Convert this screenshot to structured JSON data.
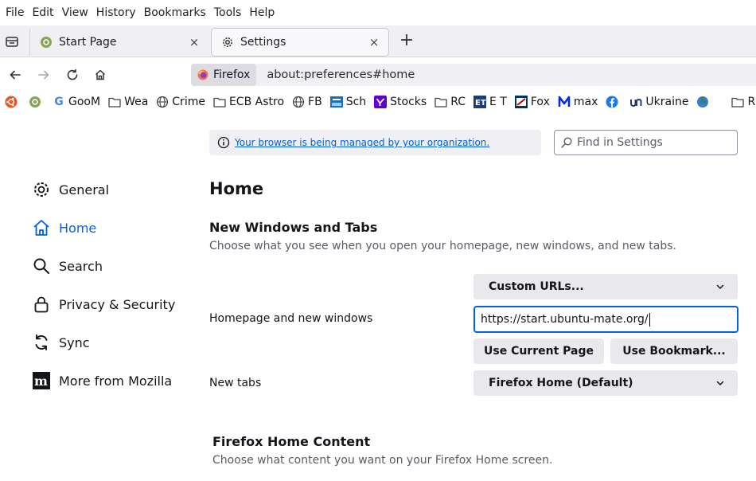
{
  "menubar": {
    "items": [
      "File",
      "Edit",
      "View",
      "History",
      "Bookmarks",
      "Tools",
      "Help"
    ]
  },
  "tabs": [
    {
      "title": "Start Page",
      "icon": "ubuntu-mate-icon",
      "close": "×"
    },
    {
      "title": "Settings",
      "icon": "gear-icon",
      "close": "×"
    }
  ],
  "new_tab": "+",
  "navbar": {
    "identity_label": "Firefox",
    "url": "about:preferences#home"
  },
  "bookmarks": [
    {
      "label": "",
      "icon": "ubuntu-icon",
      "color": "#e95420"
    },
    {
      "label": "",
      "icon": "ubuntu-mate-icon",
      "color": "#87a556"
    },
    {
      "label": "GooM",
      "icon": "google-icon",
      "color": "#4285f4"
    },
    {
      "label": "Wea",
      "icon": "folder-icon",
      "color": "#444444"
    },
    {
      "label": "Crime",
      "icon": "globe-icon",
      "color": "#444444"
    },
    {
      "label": "ECB Astro",
      "icon": "folder-icon",
      "color": "#444444"
    },
    {
      "label": "FB",
      "icon": "globe-icon",
      "color": "#444444"
    },
    {
      "label": "Sch",
      "icon": "sch-site-icon",
      "color": "#1d6fb8"
    },
    {
      "label": "Stocks",
      "icon": "yahoo-icon",
      "color": "#6001d2"
    },
    {
      "label": "RC",
      "icon": "folder-icon",
      "color": "#444444"
    },
    {
      "label": "E T",
      "icon": "et-site-icon",
      "color": "#1c3d7a"
    },
    {
      "label": "Fox",
      "icon": "fox-news-icon",
      "color": "#003366"
    },
    {
      "label": "max",
      "icon": "max-icon",
      "color": "#002be7"
    },
    {
      "label": "",
      "icon": "facebook-icon",
      "color": "#1877f2"
    },
    {
      "label": "Ukraine",
      "icon": "ukraine-site-icon",
      "color": "#1c3d7a"
    },
    {
      "label": "",
      "icon": "earth-icon",
      "color": "#2e8b57"
    },
    {
      "label": "REH",
      "icon": "folder-icon",
      "color": "#444444"
    }
  ],
  "content": {
    "policies_notice": "Your browser is being managed by your organization.",
    "find_placeholder": "Find in Settings",
    "categories": [
      {
        "label": "General",
        "icon": "gear-icon"
      },
      {
        "label": "Home",
        "icon": "home-icon",
        "selected": true
      },
      {
        "label": "Search",
        "icon": "search-icon"
      },
      {
        "label": "Privacy & Security",
        "icon": "lock-icon"
      },
      {
        "label": "Sync",
        "icon": "sync-icon"
      },
      {
        "label": "More from Mozilla",
        "icon": "mozilla-icon"
      }
    ],
    "page_title": "Home",
    "new_windows_section": {
      "title": "New Windows and Tabs",
      "description": "Choose what you see when you open your homepage, new windows, and new tabs.",
      "homepage_label": "Homepage and new windows",
      "homepage_mode": "Custom URLs...",
      "homepage_url": "https://start.ubuntu-mate.org/",
      "use_current_page": "Use Current Page",
      "use_bookmark": "Use Bookmark...",
      "new_tabs_label": "New tabs",
      "new_tabs_value": "Firefox Home (Default)"
    },
    "home_content_section": {
      "title": "Firefox Home Content",
      "description": "Choose what content you want on your Firefox Home screen."
    }
  },
  "colors": {
    "accent": "#0061e0",
    "firefox_orange": "#ff7139"
  }
}
